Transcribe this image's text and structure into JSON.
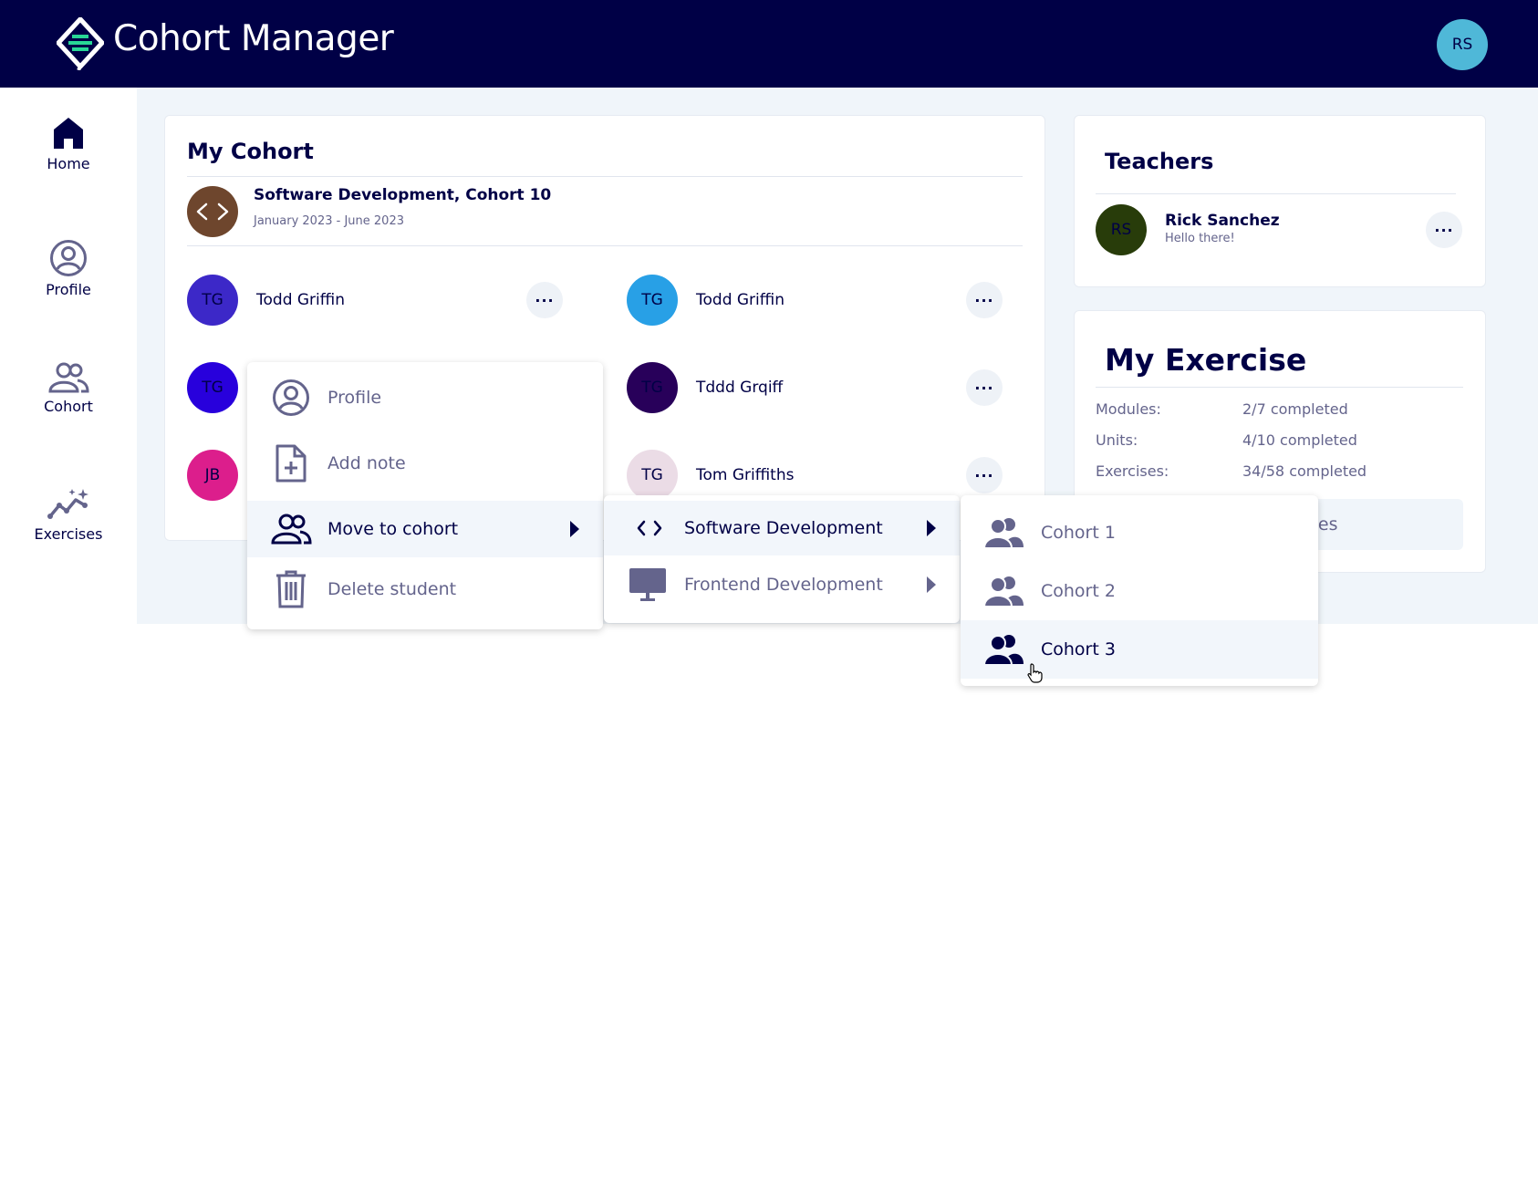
{
  "header": {
    "title": "Cohort Manager",
    "user_initials": "RS"
  },
  "sidebar": {
    "items": [
      {
        "label": "Home",
        "icon": "home-icon"
      },
      {
        "label": "Profile",
        "icon": "profile-icon"
      },
      {
        "label": "Cohort",
        "icon": "cohort-icon"
      },
      {
        "label": "Exercises",
        "icon": "exercises-icon"
      }
    ]
  },
  "my_cohort": {
    "title": "My Cohort",
    "cohort_name": "Software Development, Cohort 10",
    "cohort_dates": "January 2023 - June 2023",
    "students": [
      {
        "initials": "TG",
        "name": "Todd Griffin",
        "color": "#3c28c8"
      },
      {
        "initials": "TG",
        "name": "Todd Griffin",
        "color": "#28a0e6"
      },
      {
        "initials": "TG",
        "name": "",
        "color": "#2800dc"
      },
      {
        "initials": "TG",
        "name": "Tddd Grqiff",
        "color": "#28005a"
      },
      {
        "initials": "JB",
        "name": "",
        "color": "#dc1e8c"
      },
      {
        "initials": "TG",
        "name": "Tom Griffiths",
        "color": "#ebdce6"
      }
    ],
    "more_label": "···"
  },
  "teachers": {
    "title": "Teachers",
    "list": [
      {
        "initials": "RS",
        "name": "Rick Sanchez",
        "status": "Hello there!",
        "color": "#283c0a"
      }
    ]
  },
  "my_exercise": {
    "title": "My Exercise",
    "rows": [
      {
        "label": "Modules:",
        "value": "2/7 completed"
      },
      {
        "label": "Units:",
        "value": "4/10 completed"
      },
      {
        "label": "Exercises:",
        "value": "34/58 completed"
      }
    ],
    "button_partial": "ses"
  },
  "context_menu": {
    "items": [
      {
        "label": "Profile",
        "icon": "profile-icon"
      },
      {
        "label": "Add note",
        "icon": "add-note-icon"
      },
      {
        "label": "Move to cohort",
        "icon": "cohort-icon"
      },
      {
        "label": "Delete student",
        "icon": "trash-icon"
      }
    ]
  },
  "course_menu": {
    "items": [
      {
        "label": "Software Development",
        "icon": "code-icon"
      },
      {
        "label": "Frontend Development",
        "icon": "monitor-icon"
      }
    ]
  },
  "cohort_menu": {
    "items": [
      {
        "label": "Cohort 1",
        "icon": "cohort-icon"
      },
      {
        "label": "Cohort 2",
        "icon": "cohort-icon"
      },
      {
        "label": "Cohort 3",
        "icon": "cohort-icon"
      }
    ]
  },
  "colors": {
    "navy": "#000046",
    "grey_text": "#64648c",
    "bg": "#f0f5fa",
    "accent_green": "#28d796"
  }
}
